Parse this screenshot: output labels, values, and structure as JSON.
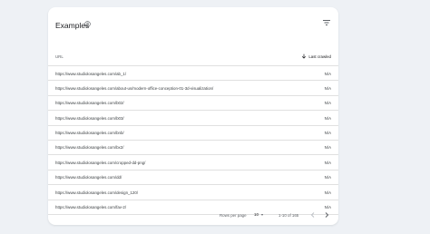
{
  "card": {
    "title": "Examples",
    "help_icon": "help-circle-icon",
    "filter_icon": "filter-icon"
  },
  "table": {
    "columns": {
      "url": "URL",
      "last_crawled": "Last crawled"
    },
    "rows": [
      {
        "url": "https://www.studiolosangeles.com/ab_1/",
        "last_crawled": "N/A"
      },
      {
        "url": "https://www.studiolosangeles.com/about-us/modern-office-conception-01-3d-visualization/",
        "last_crawled": "N/A"
      },
      {
        "url": "https://www.studiolosangeles.com/b02/",
        "last_crawled": "N/A"
      },
      {
        "url": "https://www.studiolosangeles.com/b03/",
        "last_crawled": "N/A"
      },
      {
        "url": "https://www.studiolosangeles.com/bnb/",
        "last_crawled": "N/A"
      },
      {
        "url": "https://www.studiolosangeles.com/bx2/",
        "last_crawled": "N/A"
      },
      {
        "url": "https://www.studiolosangeles.com/cropped-dd-png/",
        "last_crawled": "N/A"
      },
      {
        "url": "https://www.studiolosangeles.com/dd/",
        "last_crawled": "N/A"
      },
      {
        "url": "https://www.studiolosangeles.com/design_120/",
        "last_crawled": "N/A"
      },
      {
        "url": "https://www.studiolosangeles.com/fav-2/",
        "last_crawled": "N/A"
      }
    ]
  },
  "footer": {
    "rows_per_page_label": "Rows per page",
    "rows_per_page_value": "10",
    "range_text": "1-10 of 165"
  },
  "colors": {
    "background": "#eef1f5",
    "card": "#ffffff",
    "divider": "#e0e0e0",
    "text": "#202124",
    "muted": "#5f6368"
  }
}
